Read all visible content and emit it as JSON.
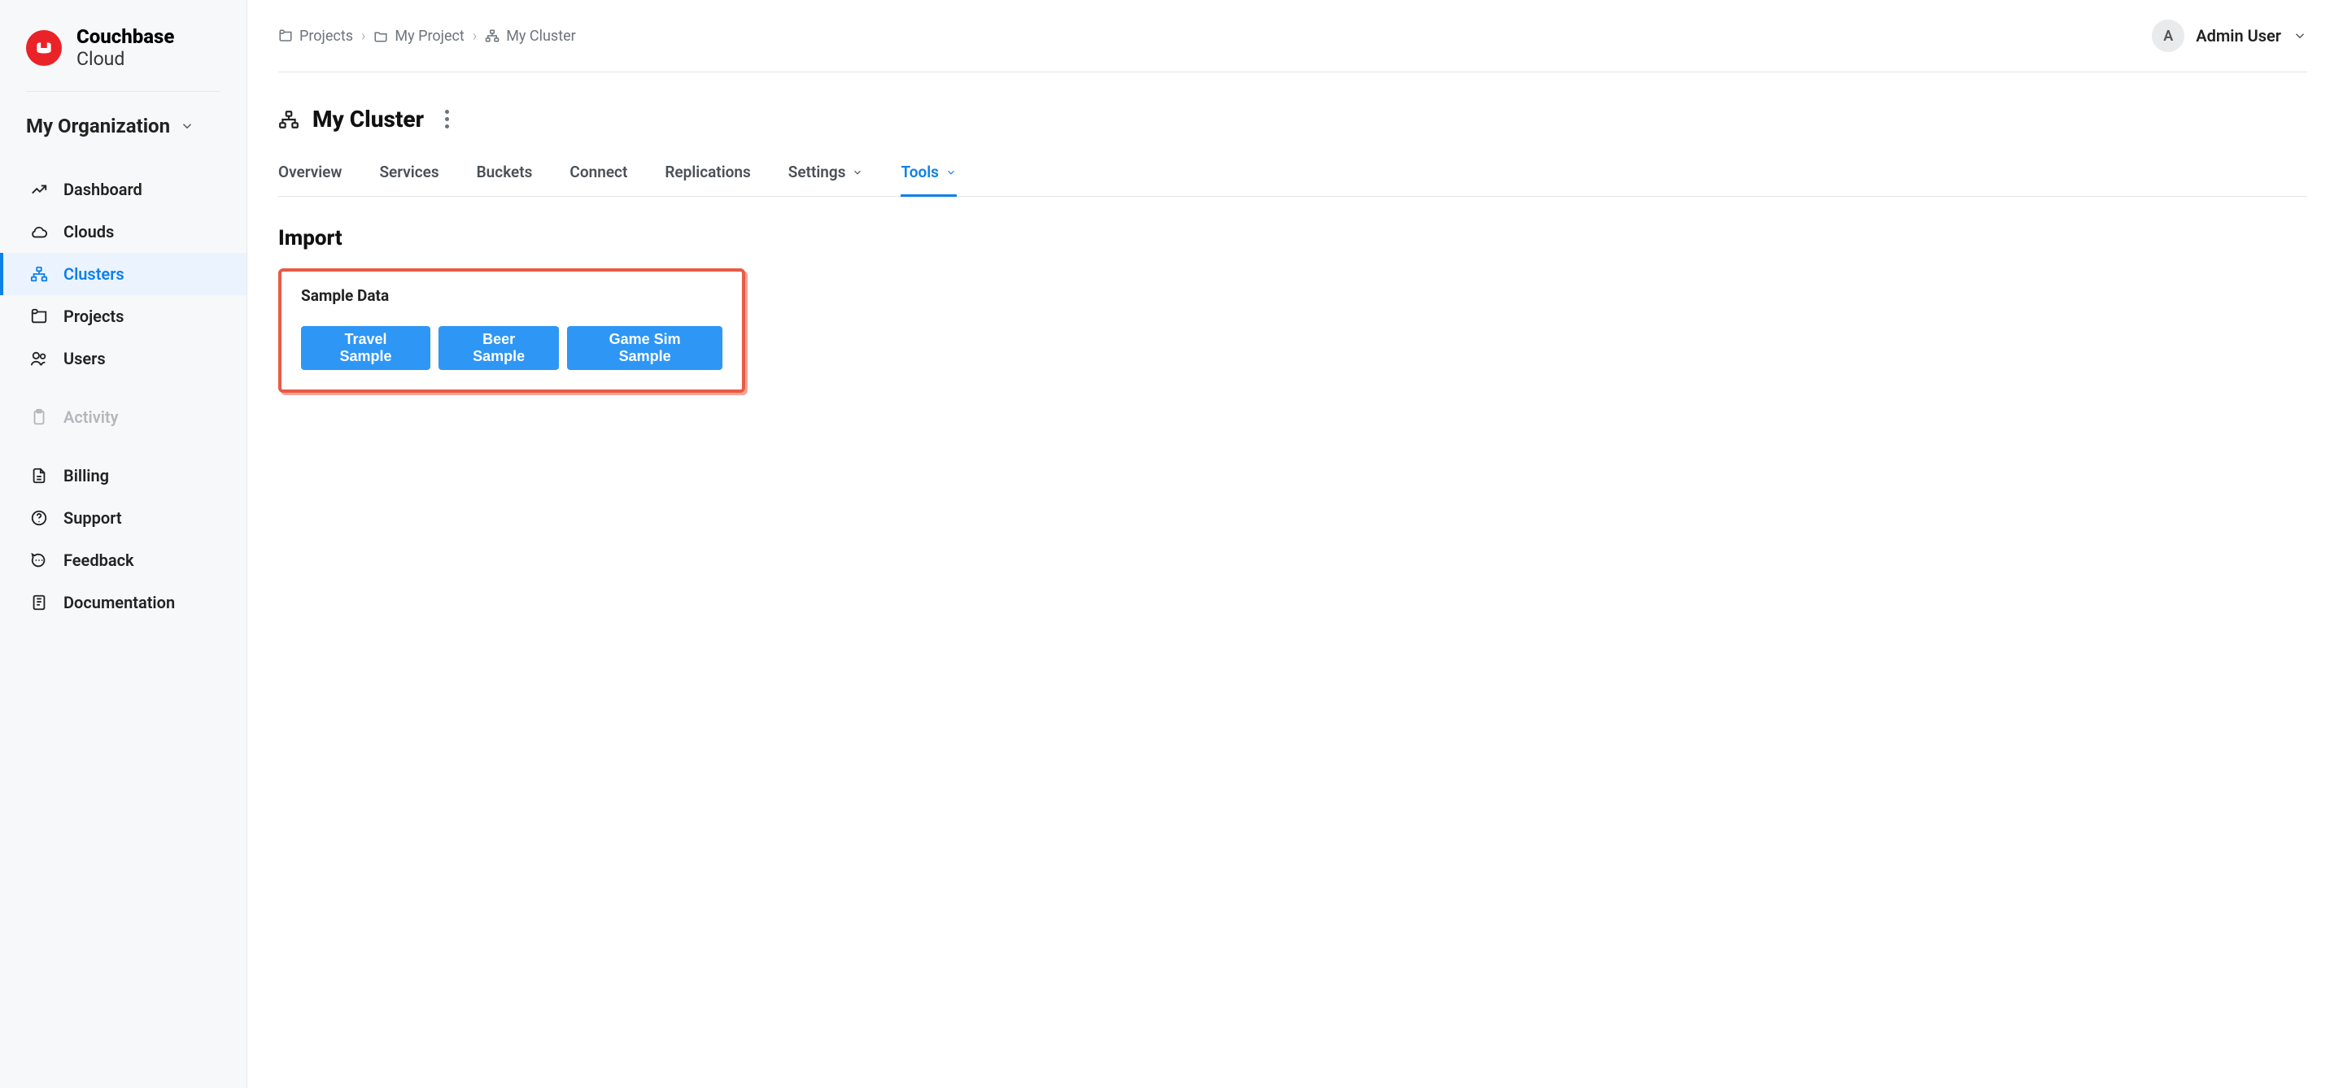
{
  "brand": {
    "line1": "Couchbase",
    "line2": "Cloud"
  },
  "org_picker": {
    "label": "My Organization"
  },
  "sidebar": {
    "items": [
      {
        "label": "Dashboard",
        "icon": "chart-line-icon"
      },
      {
        "label": "Clouds",
        "icon": "cloud-icon"
      },
      {
        "label": "Clusters",
        "icon": "cluster-icon",
        "active": true
      },
      {
        "label": "Projects",
        "icon": "projects-icon"
      },
      {
        "label": "Users",
        "icon": "users-icon"
      },
      {
        "label": "Activity",
        "icon": "clipboard-icon",
        "disabled": true
      },
      {
        "label": "Billing",
        "icon": "file-text-icon"
      },
      {
        "label": "Support",
        "icon": "help-circle-icon"
      },
      {
        "label": "Feedback",
        "icon": "message-circle-icon"
      },
      {
        "label": "Documentation",
        "icon": "book-icon"
      }
    ]
  },
  "breadcrumb": {
    "items": [
      {
        "label": "Projects",
        "icon": "projects-icon"
      },
      {
        "label": "My Project",
        "icon": "folder-icon"
      },
      {
        "label": "My Cluster",
        "icon": "cluster-icon"
      }
    ]
  },
  "user": {
    "initial": "A",
    "name": "Admin User"
  },
  "page": {
    "title": "My Cluster"
  },
  "tabs": [
    {
      "label": "Overview"
    },
    {
      "label": "Services"
    },
    {
      "label": "Buckets"
    },
    {
      "label": "Connect"
    },
    {
      "label": "Replications"
    },
    {
      "label": "Settings",
      "dropdown": true
    },
    {
      "label": "Tools",
      "dropdown": true,
      "active": true
    }
  ],
  "section": {
    "title": "Import"
  },
  "panel": {
    "title": "Sample Data",
    "buttons": [
      {
        "label": "Travel Sample"
      },
      {
        "label": "Beer Sample"
      },
      {
        "label": "Game Sim Sample"
      }
    ]
  }
}
